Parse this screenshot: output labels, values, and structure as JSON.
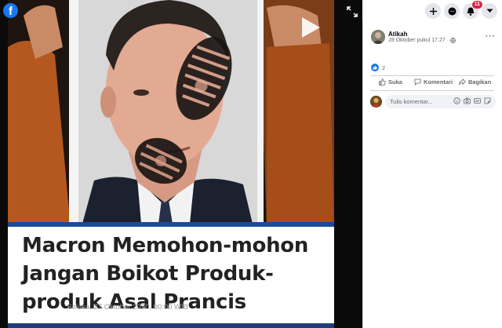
{
  "app": {
    "logo_letter": "f",
    "brand_color": "#1877f2"
  },
  "media": {
    "headline": "Macron Memohon-mohon Jangan Boikot Produk-produk Asal Prancis",
    "date": "Selasa, 27 Oktober 2020, 00:00 WIB",
    "accent_color": "#1a4a9c"
  },
  "topbar": {
    "notification_count": "11"
  },
  "post": {
    "author": "Atikah",
    "timestamp": "28 Oktober pukul 17.27",
    "separator": "·",
    "reaction_count": "2"
  },
  "actions": {
    "like": "Suka",
    "comment": "Komentari",
    "share": "Bagikan"
  },
  "comment": {
    "placeholder": "Tulis komentar..."
  }
}
